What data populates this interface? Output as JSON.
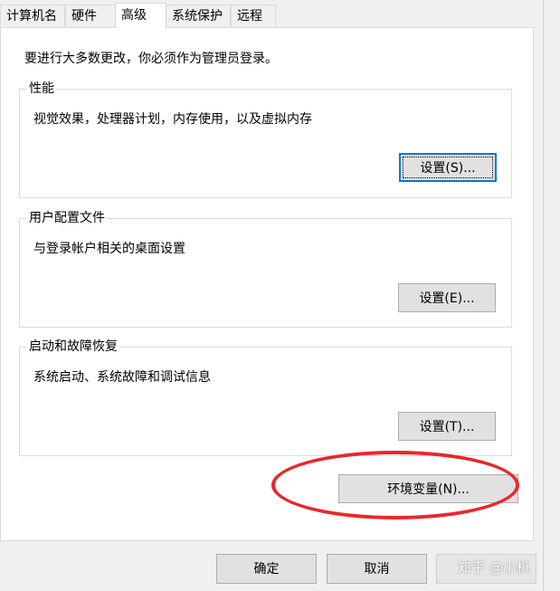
{
  "tabs": [
    "计算机名",
    "硬件",
    "高级",
    "系统保护",
    "远程"
  ],
  "admin_note": "要进行大多数更改，你必须作为管理员登录。",
  "performance": {
    "title": "性能",
    "description": "视觉效果，处理器计划，内存使用，以及虚拟内存",
    "button": "设置(S)..."
  },
  "user_profiles": {
    "title": "用户配置文件",
    "description": "与登录帐户相关的桌面设置",
    "button": "设置(E)..."
  },
  "startup_recovery": {
    "title": "启动和故障恢复",
    "description": "系统启动、系统故障和调试信息",
    "button": "设置(T)..."
  },
  "env_button": "环境变量(N)...",
  "footer": {
    "ok": "确定",
    "cancel": "取消"
  },
  "watermark": "知乎 @小机",
  "colors": {
    "highlight_oval": "#e8282b",
    "focus_border": "#0078d7"
  }
}
